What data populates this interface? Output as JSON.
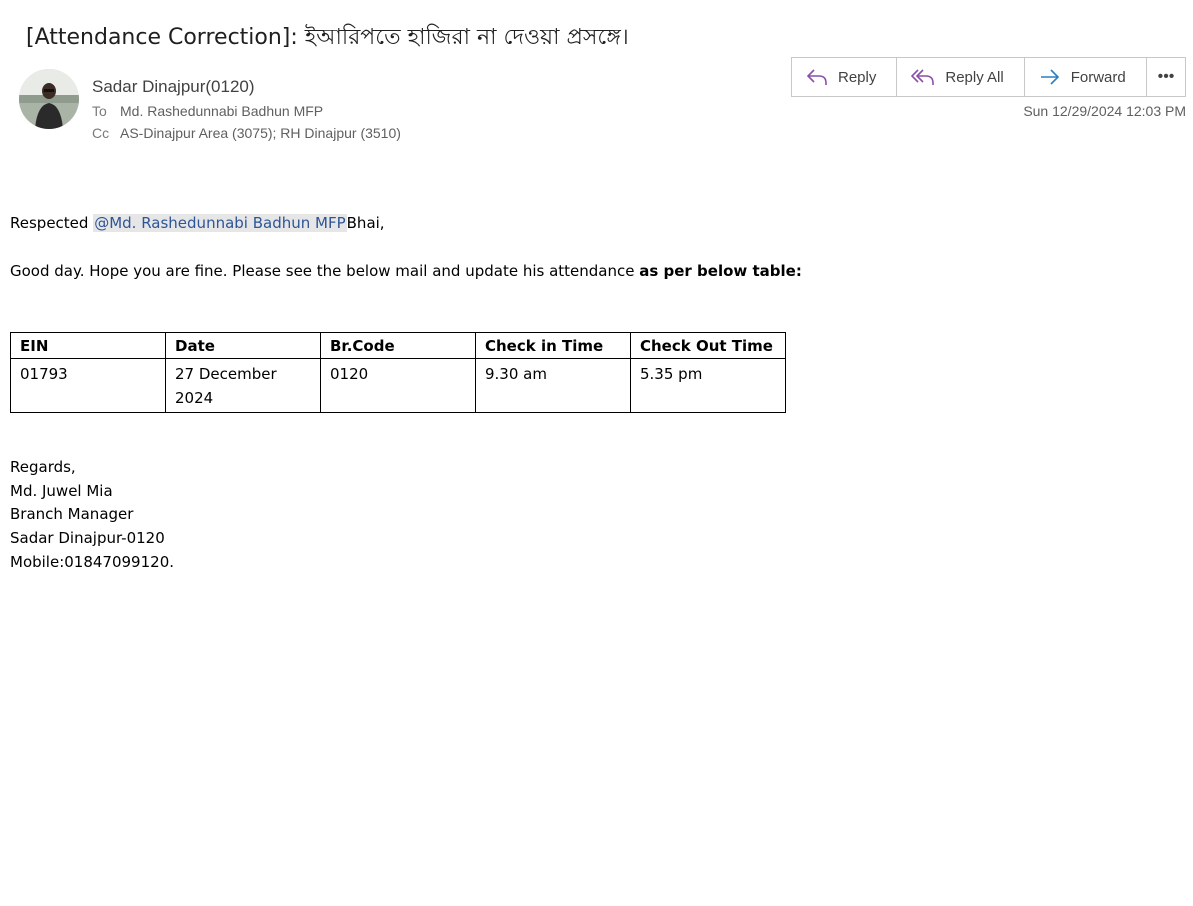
{
  "email": {
    "subject": "[Attendance Correction]: ইআরিপতে হাজিরা না দেওয়া প্রসঙ্গে।",
    "sender": "Sadar Dinajpur(0120)",
    "to_label": "To",
    "to": "Md. Rashedunnabi Badhun MFP",
    "cc_label": "Cc",
    "cc": "AS-Dinajpur Area (3075); RH Dinajpur (3510)",
    "timestamp": "Sun 12/29/2024 12:03 PM"
  },
  "actions": {
    "reply": "Reply",
    "reply_all": "Reply All",
    "forward": "Forward",
    "more": "•••"
  },
  "body": {
    "greeting_prefix": "Respected ",
    "mention": "@Md. Rashedunnabi Badhun MFP",
    "greeting_suffix": "Bhai,",
    "line2_plain": "Good day. Hope you are fine. Please see the below mail and update his attendance ",
    "line2_bold": "as per below table:"
  },
  "table": {
    "headers": [
      "EIN",
      "Date",
      "Br.Code",
      "Check in Time",
      "Check Out Time"
    ],
    "rows": [
      [
        "01793",
        "27 December 2024",
        "0120",
        "9.30 am",
        "5.35 pm"
      ]
    ]
  },
  "signature": {
    "line1": "Regards,",
    "line2": "Md. Juwel Mia",
    "line3": "Branch Manager",
    "line4": "Sadar Dinajpur-0120",
    "line5": "Mobile:01847099120."
  },
  "colors": {
    "reply_icon": "#8a4fa8",
    "forward_icon": "#2b7fc2",
    "mention_text": "#2e5597",
    "mention_bg": "#e6e6e6"
  }
}
